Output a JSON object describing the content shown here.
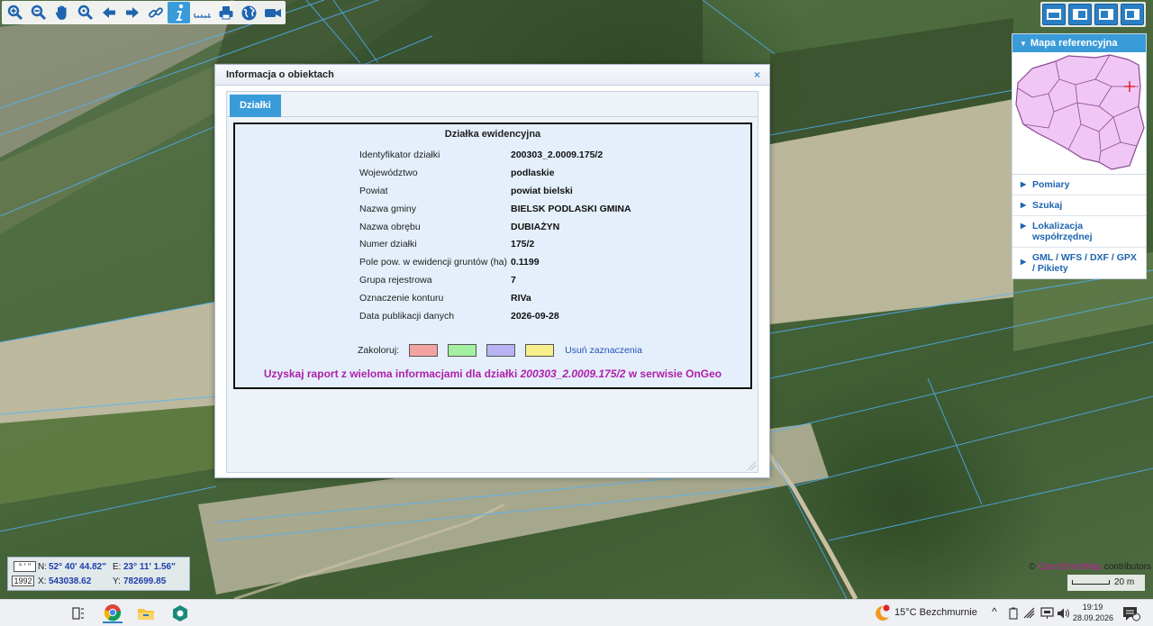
{
  "toolbar": {
    "tools": [
      "zoom-in",
      "zoom-out",
      "pan",
      "zoom-extent",
      "back",
      "forward",
      "link",
      "info",
      "measure",
      "print",
      "globe",
      "camera"
    ]
  },
  "side_panel": {
    "header": "Mapa referencyjna",
    "items": [
      {
        "label": "Pomiary"
      },
      {
        "label": "Szukaj"
      },
      {
        "label": "Lokalizacja współrzędnej"
      },
      {
        "label": "GML / WFS / DXF / GPX / Pikiety"
      }
    ]
  },
  "dialog": {
    "title": "Informacja o obiektach",
    "close": "×",
    "tab": "Działki",
    "section_title": "Działka ewidencyjna",
    "rows": [
      {
        "label": "Identyfikator działki",
        "value": "200303_2.0009.175/2"
      },
      {
        "label": "Województwo",
        "value": "podlaskie"
      },
      {
        "label": "Powiat",
        "value": "powiat bielski"
      },
      {
        "label": "Nazwa gminy",
        "value": "BIELSK PODLASKI GMINA"
      },
      {
        "label": "Nazwa obrębu",
        "value": "DUBIAŻYN"
      },
      {
        "label": "Numer działki",
        "value": "175/2"
      },
      {
        "label": "Pole pow. w ewidencji gruntów (ha)",
        "value": "0.1199"
      },
      {
        "label": "Grupa rejestrowa",
        "value": "7"
      },
      {
        "label": "Oznaczenie konturu",
        "value": "RIVa"
      },
      {
        "label": "Data publikacji danych",
        "value": "2026-09-28"
      }
    ],
    "colorize_label": "Zakoloruj:",
    "swatches": [
      "#f4a3a3",
      "#a3f0a3",
      "#b8b4f4",
      "#f7f08a"
    ],
    "clear_label": "Usuń zaznaczenia",
    "report_prefix": "Uzyskaj raport z wieloma informacjami dla działki ",
    "report_id": "200303_2.0009.175/2",
    "report_suffix": " w serwisie OnGeo"
  },
  "coords": {
    "dms_button": "° ' \"",
    "crs_button": "1992",
    "n_label": "N:",
    "n_value": "52° 40' 44.82\"",
    "e_label": "E:",
    "e_value": "23° 11' 1.56\"",
    "x_label": "X:",
    "x_value": "543038.62",
    "y_label": "Y:",
    "y_value": "782699.85"
  },
  "attribution": {
    "prefix": "© ",
    "link": "OpenStreetMap",
    "suffix": " contributors"
  },
  "scale": {
    "label": "20 m"
  },
  "taskbar": {
    "weather": "15°C  Bezchmurnie",
    "time": "19:19",
    "date": "28.09.2026",
    "notification_count": "1"
  }
}
